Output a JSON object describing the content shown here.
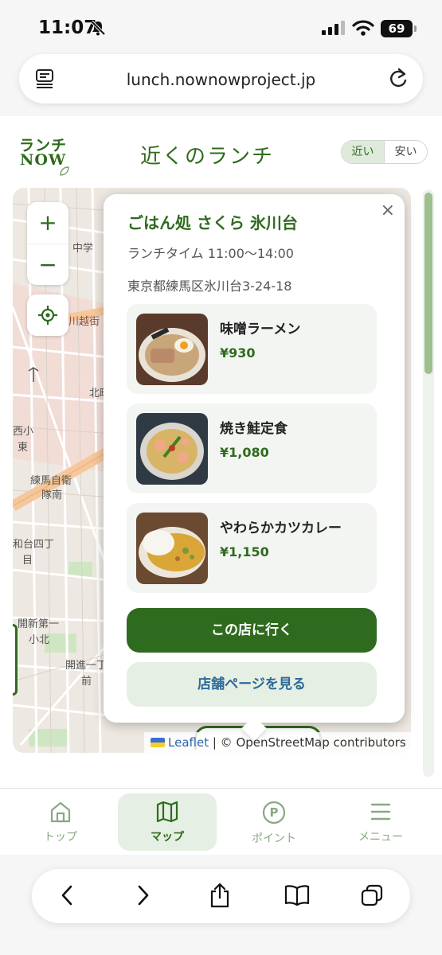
{
  "status_bar": {
    "time": "11:07",
    "battery": "69"
  },
  "browser": {
    "url": "lunch.nownowproject.jp"
  },
  "header": {
    "logo_line1": "ランチ",
    "logo_line2": "NOW",
    "title": "近くのランチ",
    "sort_options": [
      "近い",
      "安い"
    ],
    "sort_selected": "近い"
  },
  "map": {
    "zoom_in": "+",
    "zoom_out": "−",
    "attribution_leaflet": "Leaflet",
    "attribution_osm": "| © OpenStreetMap contributors",
    "labels": [
      "中学",
      "川越街道",
      "北町",
      "西小",
      "東",
      "練馬自衛",
      "隊南",
      "和台四丁",
      "目",
      "開新第一",
      "小北",
      "開進一丁",
      "前"
    ]
  },
  "popup": {
    "close": "×",
    "shop_name": "ごはん処 さくら 氷川台",
    "hours": "ランチタイム 11:00〜14:00",
    "address": "東京都練馬区氷川台3-24-18",
    "menu": [
      {
        "dish": "味噌ラーメン",
        "price": "¥930",
        "photo_icon": "ramen-photo"
      },
      {
        "dish": "焼き鮭定食",
        "price": "¥1,080",
        "photo_icon": "pasta-photo"
      },
      {
        "dish": "やわらかカツカレー",
        "price": "¥1,150",
        "photo_icon": "curry-photo"
      }
    ],
    "go_button": "この店に行く",
    "page_button": "店舗ページを見る"
  },
  "bottom_nav": {
    "items": [
      {
        "label": "トップ",
        "icon": "home-icon"
      },
      {
        "label": "マップ",
        "icon": "map-icon"
      },
      {
        "label": "ポイント",
        "icon": "points-icon"
      },
      {
        "label": "メニュー",
        "icon": "menu-icon"
      }
    ],
    "active": "マップ"
  },
  "colors": {
    "brand_green": "#2f6b1e",
    "light_green": "#e6efe3",
    "link_blue": "#2a6a98"
  }
}
